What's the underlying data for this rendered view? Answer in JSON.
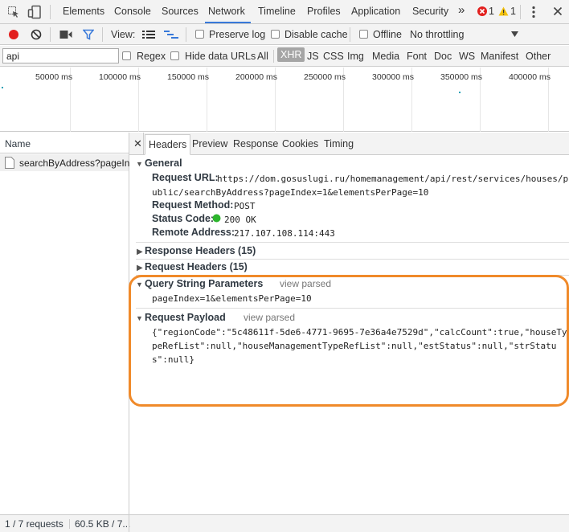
{
  "devtools_tabs": [
    "Elements",
    "Console",
    "Sources",
    "Network",
    "Timeline",
    "Profiles",
    "Application",
    "Security"
  ],
  "more_tabs_icon": "»",
  "errors_count": "1",
  "warnings_count": "1",
  "toolbar": {
    "view_label": "View:",
    "preserve_log": "Preserve log",
    "disable_cache": "Disable cache",
    "offline": "Offline",
    "throttling": "No throttling"
  },
  "filter": {
    "value": "api",
    "regex": "Regex",
    "hide_data_urls": "Hide data URLs",
    "types": [
      "All",
      "XHR",
      "JS",
      "CSS",
      "Img",
      "Media",
      "Font",
      "Doc",
      "WS",
      "Manifest",
      "Other"
    ],
    "selected_type": "XHR"
  },
  "overview": {
    "ticks": [
      "50000 ms",
      "100000 ms",
      "150000 ms",
      "200000 ms",
      "250000 ms",
      "300000 ms",
      "350000 ms",
      "400000 ms"
    ]
  },
  "requests": {
    "column_header": "Name",
    "items": [
      "searchByAddress?pageInd..."
    ]
  },
  "status_bar": {
    "requests": "1 / 7 requests",
    "size": "60.5 KB / 7..."
  },
  "detail_tabs": [
    "Headers",
    "Preview",
    "Response",
    "Cookies",
    "Timing"
  ],
  "close_icon": "✕",
  "general": {
    "title": "General",
    "request_url_label": "Request URL:",
    "request_url_line1": "https://dom.gosuslugi.ru/homemanagement/api/rest/services/houses/p",
    "request_url_line2": "ublic/searchByAddress?pageIndex=1&elementsPerPage=10",
    "request_method_label": "Request Method:",
    "request_method": "POST",
    "status_code_label": "Status Code:",
    "status_code": "200 OK",
    "status_color": "#2db52d",
    "remote_address_label": "Remote Address:",
    "remote_address": "217.107.108.114:443"
  },
  "response_headers": "Response Headers (15)",
  "request_headers": "Request Headers (15)",
  "query_string": {
    "title": "Query String Parameters",
    "view_parsed": "view parsed",
    "value": "pageIndex=1&elementsPerPage=10"
  },
  "request_payload": {
    "title": "Request Payload",
    "view_parsed": "view parsed",
    "line1": "{\"regionCode\":\"5c48611f-5de6-4771-9695-7e36a4e7529d\",\"calcCount\":true,\"houseTy",
    "line2": "peRefList\":null,\"houseManagementTypeRefList\":null,\"estStatus\":null,\"strStatu",
    "line3": "s\":null}"
  },
  "colors": {
    "highlight": "#f08a2a",
    "record": "#e2201e",
    "active_tab_underline": "#3879d9",
    "filter_icon": "#3879d9"
  }
}
